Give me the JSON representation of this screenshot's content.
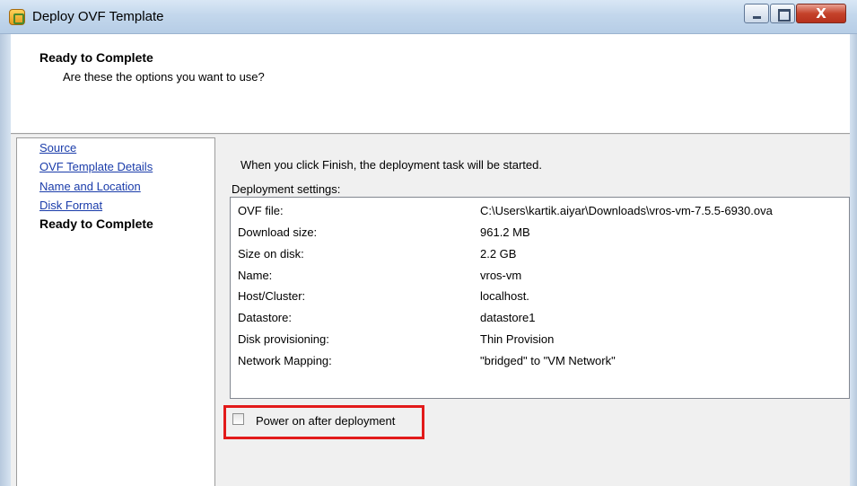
{
  "window": {
    "title": "Deploy OVF Template"
  },
  "header": {
    "title": "Ready to Complete",
    "subtitle": "Are these the options you want to use?"
  },
  "nav": {
    "items": [
      {
        "label": "Source"
      },
      {
        "label": "OVF Template Details"
      },
      {
        "label": "Name and Location"
      },
      {
        "label": "Disk Format"
      },
      {
        "label": "Ready to Complete"
      }
    ]
  },
  "content": {
    "intro": "When you click Finish, the deployment task will be started.",
    "settings_label": "Deployment settings:",
    "settings": [
      {
        "key": "OVF file:",
        "value": "C:\\Users\\kartik.aiyar\\Downloads\\vros-vm-7.5.5-6930.ova"
      },
      {
        "key": "Download size:",
        "value": "961.2 MB"
      },
      {
        "key": "Size on disk:",
        "value": "2.2 GB"
      },
      {
        "key": "Name:",
        "value": "vros-vm"
      },
      {
        "key": "Host/Cluster:",
        "value": "localhost."
      },
      {
        "key": "Datastore:",
        "value": "datastore1"
      },
      {
        "key": "Disk provisioning:",
        "value": "Thin Provision"
      },
      {
        "key": "Network Mapping:",
        "value": "\"bridged\" to \"VM Network\""
      }
    ],
    "power_on_label": "Power on after deployment",
    "power_on_checked": false
  },
  "colors": {
    "highlight": "#e21a1a",
    "link": "#1a3caa"
  }
}
